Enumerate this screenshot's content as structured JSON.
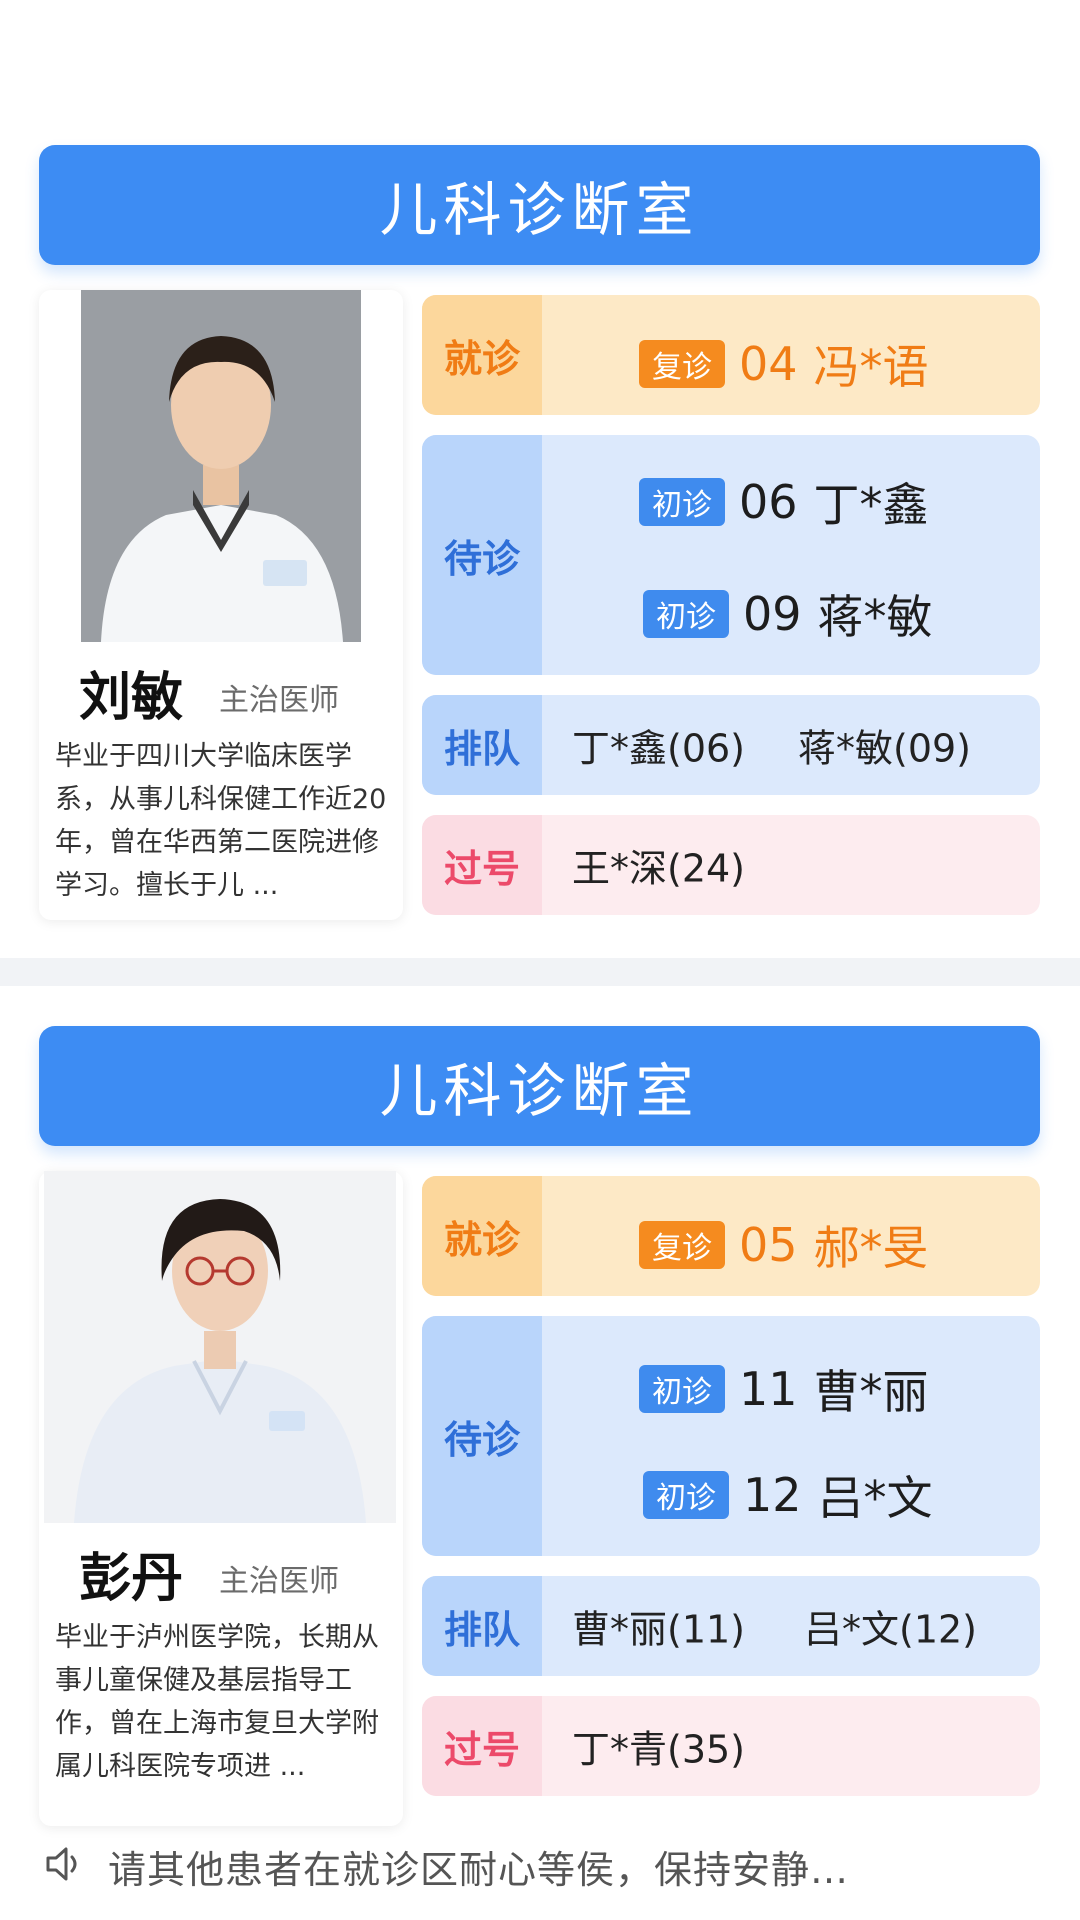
{
  "rooms": [
    {
      "title": "儿科诊断室",
      "doctor": {
        "name": "刘敏",
        "title": "主治医师",
        "bio": "毕业于四川大学临床医学系，从事儿科保健工作近20年，曾在华西第二医院进修学习。擅长于儿 ..."
      },
      "now": {
        "label": "就诊",
        "badge": "复诊",
        "number": "04",
        "patient": "冯*语"
      },
      "waiting": {
        "label": "待诊",
        "entries": [
          {
            "badge": "初诊",
            "number": "06",
            "patient": "丁*鑫"
          },
          {
            "badge": "初诊",
            "number": "09",
            "patient": "蒋*敏"
          }
        ]
      },
      "queue": {
        "label": "排队",
        "entries": [
          "丁*鑫(06)",
          "蒋*敏(09)"
        ]
      },
      "passed": {
        "label": "过号",
        "entries": [
          "王*深(24)"
        ]
      }
    },
    {
      "title": "儿科诊断室",
      "doctor": {
        "name": "彭丹",
        "title": "主治医师",
        "bio": "毕业于泸州医学院，长期从事儿童保健及基层指导工作，曾在上海市复旦大学附属儿科医院专项进 ..."
      },
      "now": {
        "label": "就诊",
        "badge": "复诊",
        "number": "05",
        "patient": "郝*旻"
      },
      "waiting": {
        "label": "待诊",
        "entries": [
          {
            "badge": "初诊",
            "number": "11",
            "patient": "曹*丽"
          },
          {
            "badge": "初诊",
            "number": "12",
            "patient": "吕*文"
          }
        ]
      },
      "queue": {
        "label": "排队",
        "entries": [
          "曹*丽(11)",
          "吕*文(12)"
        ]
      },
      "passed": {
        "label": "过号",
        "entries": [
          "丁*青(35)"
        ]
      }
    }
  ],
  "notice": {
    "icon": "speaker-icon",
    "text": "请其他患者在就诊区耐心等侯，保持安静…"
  },
  "colors": {
    "header": "#3d8cf3",
    "now_text": "#f07c15",
    "waiting_label": "#2f6fd8",
    "passed_label": "#ec4a6a",
    "revisit_badge": "#f58b1f",
    "first_visit_badge": "#3f8bee"
  }
}
